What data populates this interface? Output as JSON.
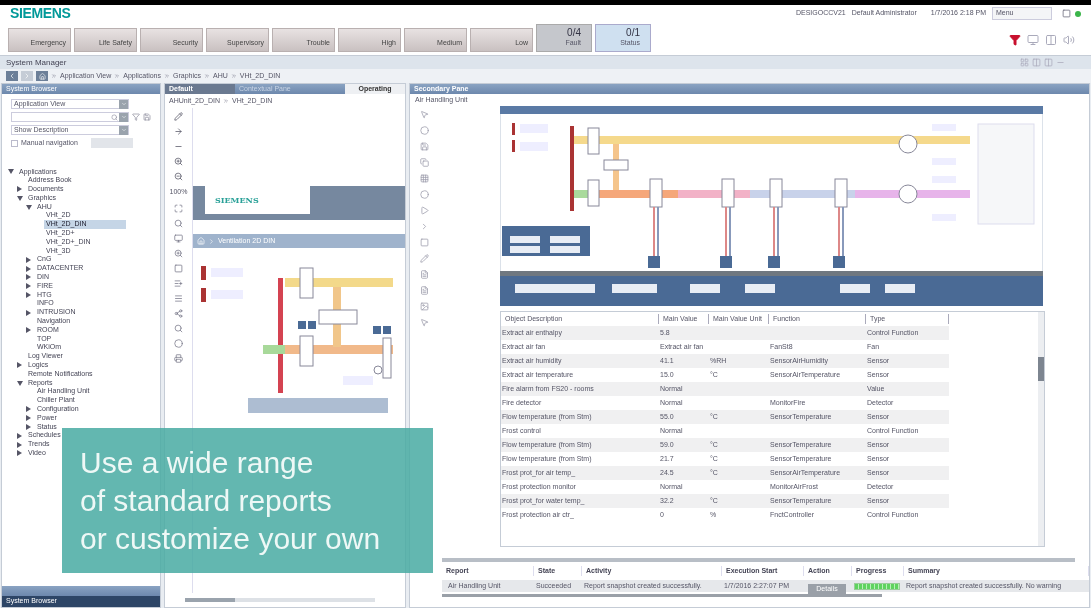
{
  "header": {
    "logo": "SIEMENS",
    "station": "DESIGOCCV21",
    "user": "Default Administrator",
    "datetime": "1/7/2016 2:18 PM",
    "menu": "Menu"
  },
  "alarm_categories": [
    {
      "label": "Emergency"
    },
    {
      "label": "Life Safety"
    },
    {
      "label": "Security"
    },
    {
      "label": "Supervisory"
    },
    {
      "label": "Trouble"
    },
    {
      "label": "High"
    },
    {
      "label": "Medium"
    },
    {
      "label": "Low"
    }
  ],
  "alarm_summaries": [
    {
      "count": "0/4",
      "label": "Fault",
      "selected": false
    },
    {
      "count": "0/1",
      "label": "Status",
      "selected": true
    }
  ],
  "title_bar": {
    "title": "System Manager"
  },
  "breadcrumb": [
    "Application View",
    "Applications",
    "Graphics",
    "AHU",
    "VHt_2D_DIN"
  ],
  "system_browser": {
    "title": "System Browser",
    "view": "Application View",
    "description_mode": "Show Description",
    "manual_navigation": {
      "label": "Manual navigation",
      "checked": false
    },
    "tree": [
      {
        "label": "Applications",
        "expanded": true,
        "selected": false,
        "children": [
          {
            "label": "Address Book",
            "selected": false
          },
          {
            "label": "Documents",
            "expanded": false,
            "selected": false
          },
          {
            "label": "Graphics",
            "expanded": true,
            "selected": false,
            "children": [
              {
                "label": "AHU",
                "expanded": true,
                "selected": false,
                "children": [
                  {
                    "label": "VHt_2D",
                    "selected": false
                  },
                  {
                    "label": "VHt_2D_DIN",
                    "selected": true
                  },
                  {
                    "label": "VHt_2D+",
                    "selected": false
                  },
                  {
                    "label": "VHt_2D+_DIN",
                    "selected": false
                  },
                  {
                    "label": "VHt_3D",
                    "selected": false
                  }
                ]
              },
              {
                "label": "CnG",
                "expanded": false,
                "selected": false
              },
              {
                "label": "DATACENTER",
                "expanded": false,
                "selected": false
              },
              {
                "label": "DIN",
                "expanded": false,
                "selected": false
              },
              {
                "label": "FIRE",
                "expanded": false,
                "selected": false
              },
              {
                "label": "HTG",
                "expanded": false,
                "selected": false
              },
              {
                "label": "INFO",
                "selected": false
              },
              {
                "label": "INTRUSION",
                "expanded": false,
                "selected": false
              },
              {
                "label": "Navigation",
                "selected": false
              },
              {
                "label": "ROOM",
                "expanded": false,
                "selected": false
              },
              {
                "label": "TOP",
                "selected": false
              },
              {
                "label": "WKiOm",
                "selected": false
              }
            ]
          },
          {
            "label": "Log Viewer",
            "selected": false
          },
          {
            "label": "Logics",
            "expanded": false,
            "selected": false
          },
          {
            "label": "Remote Notifications",
            "selected": false
          },
          {
            "label": "Reports",
            "expanded": true,
            "selected": false,
            "children": [
              {
                "label": "Air Handling Unit",
                "selected": false
              },
              {
                "label": "Chiller Plant",
                "selected": false
              },
              {
                "label": "Configuration",
                "expanded": false,
                "selected": false
              },
              {
                "label": "Power",
                "expanded": false,
                "selected": false
              },
              {
                "label": "Status",
                "expanded": false,
                "selected": false
              }
            ]
          },
          {
            "label": "Schedules",
            "expanded": false,
            "selected": false
          },
          {
            "label": "Trends",
            "expanded": false,
            "selected": false
          },
          {
            "label": "Video",
            "expanded": false,
            "selected": false
          }
        ]
      }
    ],
    "bottom_tab": {
      "label": "System Browser",
      "selected": true
    }
  },
  "primary_pane": {
    "tabs": [
      {
        "label": "Default",
        "selected": true
      },
      {
        "label": "Contextual Pane",
        "selected": false
      }
    ],
    "mode": "Operating",
    "breadcrumb": [
      "AHUnit_2D_DIN",
      "VHt_2D_DIN"
    ],
    "zoom": "100%",
    "graphic": {
      "logo": "SIEMENS",
      "title": "Ventilation 2D DIN"
    }
  },
  "secondary_pane": {
    "title": "Secondary Pane",
    "subtitle": "Air Handling Unit",
    "table": {
      "columns": [
        "Object Description",
        "Main Value",
        "Main Value Unit",
        "Function",
        "Type"
      ],
      "rows": [
        [
          "Extract air enthalpy",
          "5.8",
          "",
          "",
          "Control Function"
        ],
        [
          "Extract air fan",
          "Extract air fan",
          "",
          "FanSt8",
          "Fan"
        ],
        [
          "Extract air humidity",
          "41.1",
          "%RH",
          "SensorAirHumidity",
          "Sensor"
        ],
        [
          "Extract air temperature",
          "15.0",
          "°C",
          "SensorAirTemperature",
          "Sensor"
        ],
        [
          "Fire alarm from FS20 - rooms",
          "Normal",
          "",
          "",
          "Value"
        ],
        [
          "Fire detector",
          "Normal",
          "",
          "MonitorFire",
          "Detector"
        ],
        [
          "Flow temperature (from Stm)",
          "55.0",
          "°C",
          "SensorTemperature",
          "Sensor"
        ],
        [
          "Frost control",
          "Normal",
          "",
          "",
          "Control Function"
        ],
        [
          "Flow temperature (from Stm)",
          "59.0",
          "°C",
          "SensorTemperature",
          "Sensor"
        ],
        [
          "Flow temperature (from Stm)",
          "21.7",
          "°C",
          "SensorTemperature",
          "Sensor"
        ],
        [
          "Frost prot_for air temp_",
          "24.5",
          "°C",
          "SensorAirTemperature",
          "Sensor"
        ],
        [
          "Frost protection monitor",
          "Normal",
          "",
          "MonitorAirFrost",
          "Detector"
        ],
        [
          "Frost prot_for water temp_",
          "32.2",
          "°C",
          "SensorTemperature",
          "Sensor"
        ],
        [
          "Frost protection air ctr_",
          "0",
          "%",
          "FnctController",
          "Control Function"
        ]
      ]
    }
  },
  "reports": {
    "columns": [
      "Report",
      "State",
      "Activity",
      "Execution Start",
      "Action",
      "Progress",
      "Summary"
    ],
    "rows": [
      {
        "report": "Air Handling Unit",
        "state": "Succeeded",
        "activity": "Report snapshot created successfully.",
        "start": "1/7/2016 2:27:07 PM",
        "action": "Details",
        "level": 1,
        "summary": "Report snapshot created successfully. No warning"
      }
    ]
  },
  "caption": {
    "lines": [
      "Use a wide range",
      "of standard reports",
      "or customize your own"
    ]
  }
}
